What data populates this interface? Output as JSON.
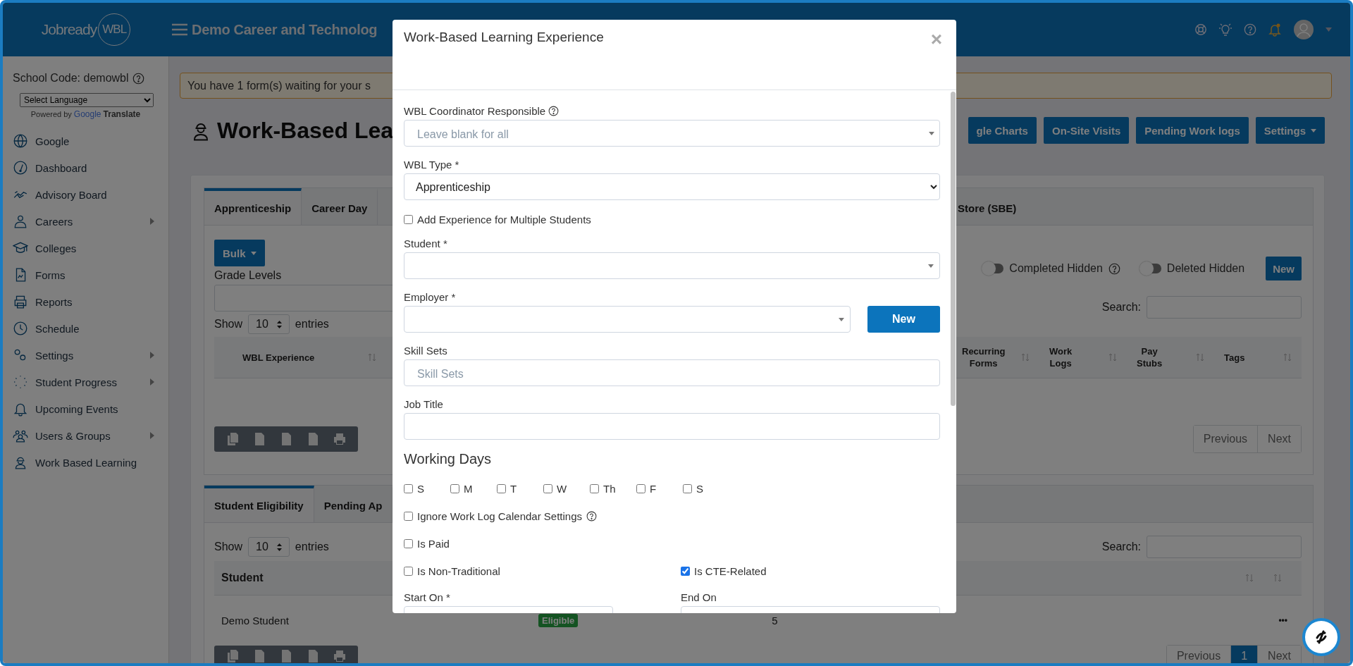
{
  "header": {
    "logo": "Jobready",
    "logo_badge": "WBL",
    "title": "Demo Career and Technolog"
  },
  "sidebar": {
    "school_code": "School Code: demowbl",
    "language_select": "Select Language",
    "powered_by": "Powered by",
    "google": "Google",
    "translate": "Translate",
    "items": [
      {
        "label": "Google",
        "expandable": false
      },
      {
        "label": "Dashboard",
        "expandable": false
      },
      {
        "label": "Advisory Board",
        "expandable": false
      },
      {
        "label": "Careers",
        "expandable": true
      },
      {
        "label": "Colleges",
        "expandable": false
      },
      {
        "label": "Forms",
        "expandable": false
      },
      {
        "label": "Reports",
        "expandable": false
      },
      {
        "label": "Schedule",
        "expandable": false
      },
      {
        "label": "Settings",
        "expandable": true
      },
      {
        "label": "Student Progress",
        "expandable": true
      },
      {
        "label": "Upcoming Events",
        "expandable": false
      },
      {
        "label": "Users & Groups",
        "expandable": true
      },
      {
        "label": "Work Based Learning",
        "expandable": false
      }
    ]
  },
  "alert": "You have 1 form(s) waiting for your s",
  "page_title": "Work-Based Lea",
  "action_buttons": [
    {
      "label": "gle Charts",
      "dropdown": false
    },
    {
      "label": "On-Site Visits",
      "dropdown": false
    },
    {
      "label": "Pending Work logs",
      "dropdown": false
    },
    {
      "label": "Settings",
      "dropdown": true
    }
  ],
  "experiences": {
    "tabs": [
      {
        "label": "Apprenticeship",
        "selected": true
      },
      {
        "label": "Career Day",
        "selected": false
      },
      {
        "label": "Store (SBE)",
        "selected": false
      }
    ],
    "bulk_button": {
      "label": "Bulk",
      "dropdown": true
    },
    "grade_levels_label": "Grade Levels",
    "toggles": [
      {
        "label": "Completed Hidden",
        "on": false,
        "help": true
      },
      {
        "label": "Deleted Hidden",
        "on": false,
        "help": false
      }
    ],
    "new_button": "New",
    "show": "Show",
    "page_size": "10",
    "entries": "entries",
    "search_label": "Search:",
    "first_column": "WBL Experience",
    "columns": [
      {
        "line1": "Recurring",
        "line2": "Forms"
      },
      {
        "line1": "Work",
        "line2": "Logs"
      },
      {
        "line1": "Pay",
        "line2": "Stubs"
      },
      {
        "line1": "Tags"
      }
    ],
    "pagination": [
      {
        "label": "Previous",
        "selected": false
      },
      {
        "label": "Next",
        "selected": false
      }
    ]
  },
  "eligibility": {
    "tabs": [
      {
        "label": "Student Eligibility",
        "selected": true
      },
      {
        "label": "Pending Ap",
        "selected": false
      }
    ],
    "show": "Show",
    "page_size": "10",
    "entries": "entries",
    "search_label": "Search:",
    "first_column": "Student",
    "rows": [
      {
        "student": "Demo Student",
        "status": "Eligible",
        "count": "5",
        "more": "•••"
      }
    ],
    "pagination": [
      {
        "label": "Previous",
        "selected": false
      },
      {
        "label": "1",
        "selected": true
      },
      {
        "label": "Next",
        "selected": false
      }
    ]
  },
  "modal": {
    "title": "Work-Based Learning Experience",
    "close": "×",
    "coordinator": {
      "label": "WBL Coordinator Responsible",
      "placeholder": "Leave blank for all"
    },
    "wbl_type": {
      "label": "WBL Type *",
      "value": "Apprenticeship"
    },
    "multiple_students": {
      "label": "Add Experience for Multiple Students",
      "checked": false
    },
    "student": {
      "label": "Student *"
    },
    "employer": {
      "label": "Employer *",
      "new_button": "New"
    },
    "skill_sets": {
      "label": "Skill Sets",
      "placeholder": "Skill Sets"
    },
    "job_title": {
      "label": "Job Title"
    },
    "working_days": {
      "heading": "Working Days",
      "days": [
        {
          "label": "S",
          "checked": false
        },
        {
          "label": "M",
          "checked": false
        },
        {
          "label": "T",
          "checked": false
        },
        {
          "label": "W",
          "checked": false
        },
        {
          "label": "Th",
          "checked": false
        },
        {
          "label": "F",
          "checked": false
        },
        {
          "label": "S",
          "checked": false
        }
      ]
    },
    "options": [
      {
        "label": "Ignore Work Log Calendar Settings",
        "checked": false,
        "help": true
      },
      {
        "label": "Is Paid",
        "checked": false,
        "help": false
      }
    ],
    "flags": [
      {
        "label": "Is Non-Traditional",
        "checked": false
      },
      {
        "label": "Is CTE-Related",
        "checked": true
      }
    ],
    "dates": [
      {
        "label": "Start On *"
      },
      {
        "label": "End On"
      }
    ]
  }
}
